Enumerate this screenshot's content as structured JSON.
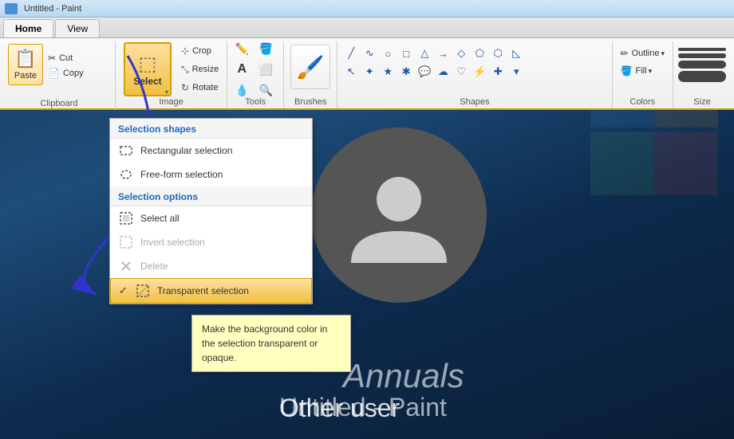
{
  "app": {
    "title": "Untitled - Paint"
  },
  "tabs": [
    {
      "label": "Home",
      "active": true
    },
    {
      "label": "View",
      "active": false
    }
  ],
  "sections": {
    "clipboard": {
      "label": "Clipboard",
      "paste": "Paste",
      "cut": "Cut",
      "copy": "Copy"
    },
    "image": {
      "label": "Image",
      "select": "Select",
      "crop": "Crop",
      "resize": "Resize",
      "rotate": "Rotate"
    },
    "tools": {
      "label": "Tools"
    },
    "brushes": {
      "label": "Brushes"
    },
    "shapes": {
      "label": "Shapes"
    },
    "colors": {
      "label": "Colors",
      "outline": "Outline",
      "fill": "Fill"
    },
    "size": {
      "label": "Size"
    }
  },
  "dropdown": {
    "selection_shapes_header": "Selection shapes",
    "items_shapes": [
      {
        "id": "rectangular",
        "label": "Rectangular selection",
        "icon": "rect",
        "disabled": false
      },
      {
        "id": "freeform",
        "label": "Free-form selection",
        "icon": "circle-dash",
        "disabled": false
      }
    ],
    "selection_options_header": "Selection options",
    "items_options": [
      {
        "id": "select-all",
        "label": "Select all",
        "icon": "select-all",
        "disabled": false
      },
      {
        "id": "invert",
        "label": "Invert selection",
        "icon": "invert",
        "disabled": true
      },
      {
        "id": "delete",
        "label": "Delete",
        "icon": "delete",
        "disabled": true
      },
      {
        "id": "transparent",
        "label": "Transparent selection",
        "icon": "transparent",
        "checked": true,
        "active": true,
        "disabled": false
      }
    ]
  },
  "tooltip": {
    "text": "Make the background color in the selection transparent or opaque."
  },
  "arrow": {
    "color": "#3333cc"
  }
}
